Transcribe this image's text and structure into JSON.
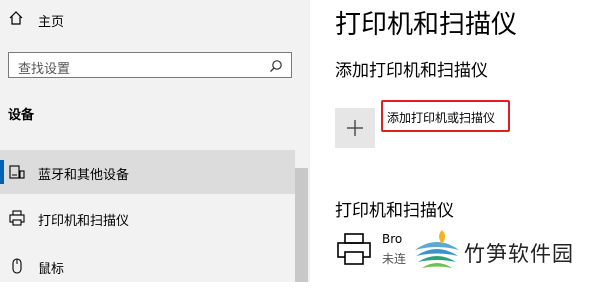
{
  "sidebar": {
    "home_label": "主页",
    "search_placeholder": "查找设置",
    "section_title": "设备",
    "items": [
      {
        "label": "蓝牙和其他设备",
        "icon": "bluetooth-devices-icon",
        "selected": true
      },
      {
        "label": "打印机和扫描仪",
        "icon": "printer-icon",
        "selected": false
      },
      {
        "label": "鼠标",
        "icon": "mouse-icon",
        "selected": false
      }
    ]
  },
  "main": {
    "page_title": "打印机和扫描仪",
    "add_section_title": "添加打印机和扫描仪",
    "add_button_label": "添加打印机或扫描仪",
    "list_section_title": "打印机和扫描仪",
    "printer": {
      "name": "Bro",
      "status": "未连"
    }
  },
  "overlay": {
    "logo_text": "竹笋软件园"
  },
  "colors": {
    "accent": "#0063b1",
    "highlight_border": "#e02020",
    "sidebar_bg": "#f2f2f2"
  }
}
